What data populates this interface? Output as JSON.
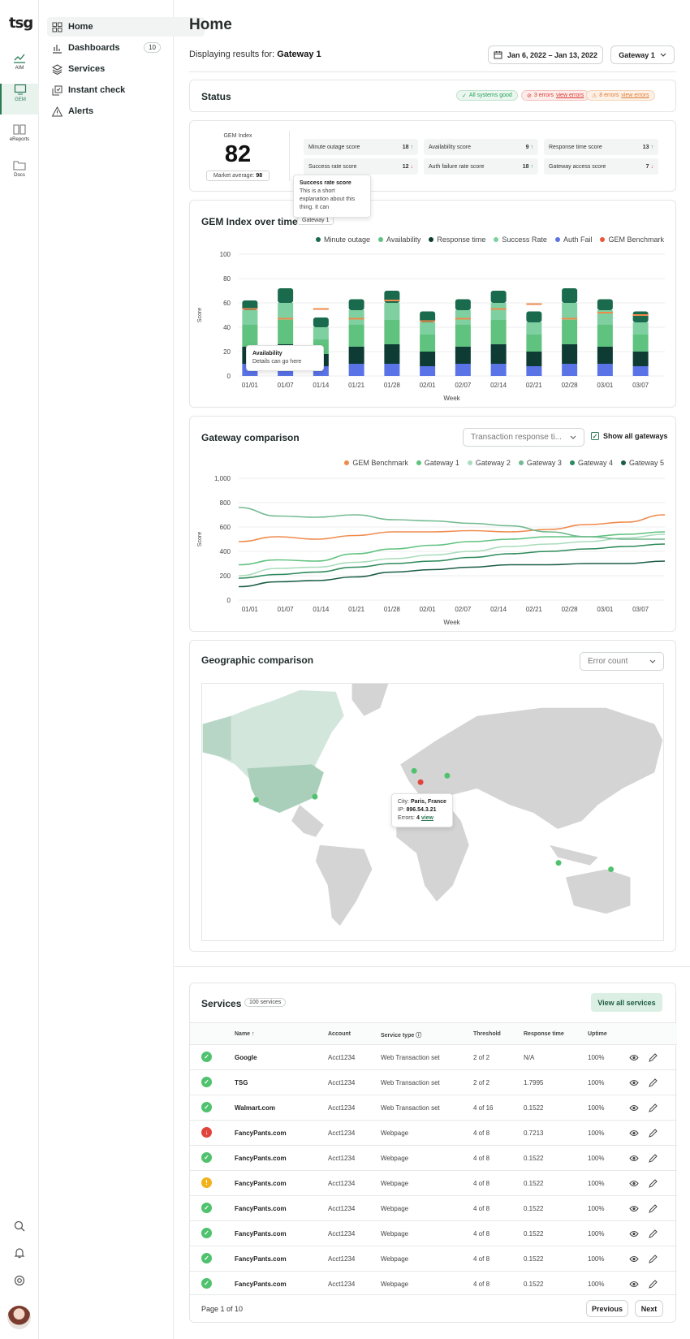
{
  "rail": {
    "logo": "tsg",
    "items": [
      {
        "label": "AIM",
        "icon": "trend-chart-icon"
      },
      {
        "label": "GEM",
        "icon": "monitor-icon"
      },
      {
        "label": "eReports",
        "icon": "book-icon"
      },
      {
        "label": "Docs",
        "icon": "folder-icon"
      }
    ],
    "active": "GEM"
  },
  "nav": {
    "items": [
      {
        "label": "Home",
        "icon": "grid-icon"
      },
      {
        "label": "Dashboards",
        "icon": "bar-chart-icon",
        "badge": "10"
      },
      {
        "label": "Services",
        "icon": "layers-icon"
      },
      {
        "label": "Instant check",
        "icon": "check-copy-icon"
      },
      {
        "label": "Alerts",
        "icon": "alert-triangle-icon"
      }
    ],
    "active": "Home"
  },
  "header": {
    "title": "Home",
    "displaying": "Displaying results for:",
    "gateway": "Gateway 1",
    "date_range": "Jan 6, 2022 – Jan 13, 2022",
    "gateway_select": "Gateway 1"
  },
  "status": {
    "title": "Status",
    "good": "All systems good",
    "errors": "3 errors",
    "errors_link": "view errors",
    "warnings": "8 errors",
    "warnings_link": "view errors"
  },
  "gem": {
    "label": "GEM Index",
    "value": "82",
    "market_label": "Market average:",
    "market_value": "98",
    "scores": [
      {
        "label": "Minute outage score",
        "value": "18",
        "dir": "up"
      },
      {
        "label": "Availability score",
        "value": "9",
        "dir": "up"
      },
      {
        "label": "Response time score",
        "value": "13",
        "dir": "up"
      },
      {
        "label": "Success rate score",
        "value": "12",
        "dir": "down"
      },
      {
        "label": "Auth failure rate score",
        "value": "18",
        "dir": "up"
      },
      {
        "label": "Gateway access score",
        "value": "7",
        "dir": "down"
      }
    ],
    "tooltip": {
      "title": "Success rate score",
      "body": "This is a short explanation about this thing. It can"
    }
  },
  "gem_chart": {
    "title": "GEM Index over time",
    "badge": "Gateway 1",
    "tooltip_title": "Availability",
    "tooltip_body": "Details can go here"
  },
  "gateway": {
    "title": "Gateway comparison",
    "select": "Transaction response ti...",
    "show_all": "Show all gateways"
  },
  "geo": {
    "title": "Geographic comparison",
    "select": "Error count",
    "tip_city_label": "City:",
    "tip_city": "Paris, France",
    "tip_ip_label": "IP:",
    "tip_ip": "896.54.3.21",
    "tip_err_label": "Errors:",
    "tip_err": "4",
    "tip_link": "view"
  },
  "services": {
    "title": "Services",
    "count": "100 services",
    "view_all": "View all services",
    "columns": [
      "Name",
      "Account",
      "Service type",
      "Threshold",
      "Response time",
      "Uptime"
    ],
    "rows": [
      {
        "status": "ok",
        "name": "Google",
        "account": "Acct1234",
        "type": "Web Transaction set",
        "threshold": "2 of 2",
        "response": "N/A",
        "uptime": "100%"
      },
      {
        "status": "ok",
        "name": "TSG",
        "account": "Acct1234",
        "type": "Web Transaction set",
        "threshold": "2 of 2",
        "response": "1.7995",
        "uptime": "100%"
      },
      {
        "status": "ok",
        "name": "Walmart.com",
        "account": "Acct1234",
        "type": "Web Transaction set",
        "threshold": "4 of 16",
        "response": "0.1522",
        "uptime": "100%"
      },
      {
        "status": "error",
        "name": "FancyPants.com",
        "account": "Acct1234",
        "type": "Webpage",
        "threshold": "4 of 8",
        "response": "0.7213",
        "uptime": "100%"
      },
      {
        "status": "ok",
        "name": "FancyPants.com",
        "account": "Acct1234",
        "type": "Webpage",
        "threshold": "4 of 8",
        "response": "0.1522",
        "uptime": "100%"
      },
      {
        "status": "warn",
        "name": "FancyPants.com",
        "account": "Acct1234",
        "type": "Webpage",
        "threshold": "4 of 8",
        "response": "0.1522",
        "uptime": "100%"
      },
      {
        "status": "ok",
        "name": "FancyPants.com",
        "account": "Acct1234",
        "type": "Webpage",
        "threshold": "4 of 8",
        "response": "0.1522",
        "uptime": "100%"
      },
      {
        "status": "ok",
        "name": "FancyPants.com",
        "account": "Acct1234",
        "type": "Webpage",
        "threshold": "4 of 8",
        "response": "0.1522",
        "uptime": "100%"
      },
      {
        "status": "ok",
        "name": "FancyPants.com",
        "account": "Acct1234",
        "type": "Webpage",
        "threshold": "4 of 8",
        "response": "0.1522",
        "uptime": "100%"
      },
      {
        "status": "ok",
        "name": "FancyPants.com",
        "account": "Acct1234",
        "type": "Webpage",
        "threshold": "4 of 8",
        "response": "0.1522",
        "uptime": "100%"
      }
    ],
    "page": "Page 1 of 10",
    "prev": "Previous",
    "next": "Next"
  },
  "colors": {
    "accent": "#2b7a55",
    "minute": "#1a6b4e",
    "avail": "#5fc27e",
    "response": "#0e3b34",
    "success": "#7fd0a0",
    "auth": "#5a73e6",
    "bench": "#f08a4b",
    "gw1": "#5fc27e",
    "gw2": "#a9dcbc",
    "gw3": "#72b98f",
    "gw4": "#2d8a5c",
    "gw5": "#1c5e45"
  },
  "chart_data": [
    {
      "type": "bar",
      "stacked": true,
      "title": "GEM Index over time",
      "xlabel": "Week",
      "ylabel": "Score",
      "ylim": [
        0,
        100
      ],
      "categories": [
        "01/01",
        "01/07",
        "01/14",
        "01/21",
        "01/28",
        "02/01",
        "02/07",
        "02/14",
        "02/21",
        "02/28",
        "03/01",
        "03/07"
      ],
      "series": [
        {
          "name": "Auth Fail",
          "values": [
            10,
            10,
            8,
            10,
            10,
            8,
            10,
            10,
            8,
            10,
            10,
            8
          ]
        },
        {
          "name": "Response time",
          "values": [
            14,
            16,
            10,
            14,
            16,
            12,
            14,
            16,
            12,
            16,
            14,
            12
          ]
        },
        {
          "name": "Availability",
          "values": [
            18,
            20,
            12,
            18,
            20,
            14,
            18,
            20,
            14,
            20,
            18,
            14
          ]
        },
        {
          "name": "Success Rate",
          "values": [
            12,
            14,
            10,
            12,
            14,
            10,
            12,
            14,
            10,
            14,
            12,
            10
          ]
        },
        {
          "name": "Minute outage",
          "values": [
            8,
            12,
            8,
            9,
            10,
            9,
            9,
            10,
            9,
            12,
            9,
            9
          ]
        },
        {
          "name": "GEM Benchmark",
          "values": [
            55,
            47,
            55,
            47,
            62,
            45,
            47,
            55,
            59,
            47,
            52,
            50
          ]
        }
      ],
      "grid": true,
      "legend": "top-right"
    },
    {
      "type": "line",
      "title": "Gateway comparison",
      "xlabel": "Week",
      "ylabel": "Score",
      "ylim": [
        0,
        1000
      ],
      "x": [
        "01/01",
        "01/07",
        "01/14",
        "01/21",
        "01/28",
        "02/01",
        "02/07",
        "02/14",
        "02/21",
        "02/28",
        "03/01",
        "03/07"
      ],
      "series": [
        {
          "name": "GEM Benchmark",
          "values": [
            480,
            520,
            500,
            530,
            560,
            560,
            570,
            560,
            580,
            620,
            640,
            700
          ]
        },
        {
          "name": "Gateway 1",
          "values": [
            290,
            330,
            320,
            380,
            420,
            450,
            480,
            500,
            520,
            520,
            540,
            560
          ]
        },
        {
          "name": "Gateway 2",
          "values": [
            200,
            260,
            270,
            310,
            340,
            370,
            400,
            440,
            460,
            480,
            510,
            540
          ]
        },
        {
          "name": "Gateway 3",
          "values": [
            760,
            690,
            680,
            700,
            660,
            650,
            630,
            610,
            560,
            520,
            500,
            500
          ]
        },
        {
          "name": "Gateway 4",
          "values": [
            180,
            210,
            230,
            270,
            300,
            320,
            350,
            380,
            400,
            420,
            440,
            460
          ]
        },
        {
          "name": "Gateway 5",
          "values": [
            110,
            150,
            160,
            190,
            230,
            250,
            270,
            290,
            290,
            300,
            300,
            320
          ]
        }
      ],
      "grid": true,
      "legend": "top-right"
    }
  ]
}
